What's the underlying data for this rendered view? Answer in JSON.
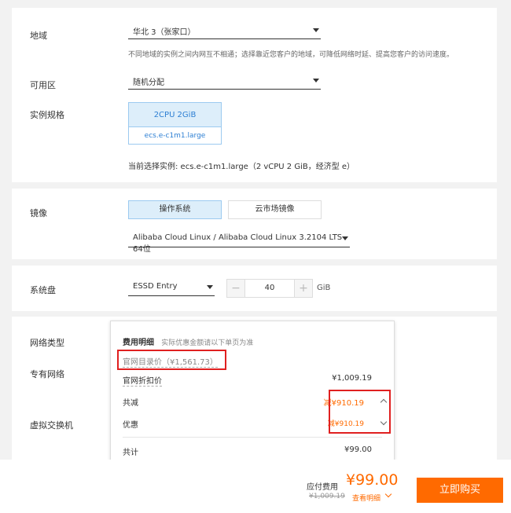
{
  "region": {
    "label": "地域",
    "value": "华北 3（张家口）",
    "hint": "不同地域的实例之间内网互不相通；选择靠近您客户的地域，可降低网络时延、提高您客户的访问速度。"
  },
  "zone": {
    "label": "可用区",
    "value": "随机分配"
  },
  "spec": {
    "label": "实例规格",
    "cpu_mem": "2CPU 2GiB",
    "type": "ecs.e-c1m1.large",
    "current": "当前选择实例: ecs.e-c1m1.large（2 vCPU 2 GiB，经济型 e）"
  },
  "image": {
    "label": "镜像",
    "tab_os": "操作系统",
    "tab_market": "云市场镜像",
    "value": "Alibaba Cloud Linux / Alibaba Cloud Linux 3.2104 LTS 64位"
  },
  "disk": {
    "label": "系统盘",
    "type": "ESSD Entry",
    "minus": "−",
    "size": "40",
    "plus": "+",
    "unit": "GiB"
  },
  "network": {
    "label_type": "网络类型",
    "label_vpc": "专有网络",
    "label_vswitch": "虚拟交换机"
  },
  "fee": {
    "title": "费用明细",
    "note": "实际优惠金额请以下单页为准",
    "list_price": "官网目录价（¥1,561.73）",
    "discount_label": "官网折扣价",
    "discount_value": "¥1,009.19",
    "total_reduce_label": "共减",
    "total_reduce_value": "减¥910.19",
    "promo_label": "优惠",
    "promo_value": "减¥910.19",
    "sum_label": "共计",
    "sum_value": "¥99.00"
  },
  "footer": {
    "payable_label": "应付费用",
    "price": "¥99.00",
    "original": "¥1,009.19",
    "details": "查看明细",
    "buy": "立即购买"
  },
  "colors": {
    "accent": "#ff6a00",
    "blue": "#2d7fd3",
    "highlight_box": "#e02020"
  }
}
